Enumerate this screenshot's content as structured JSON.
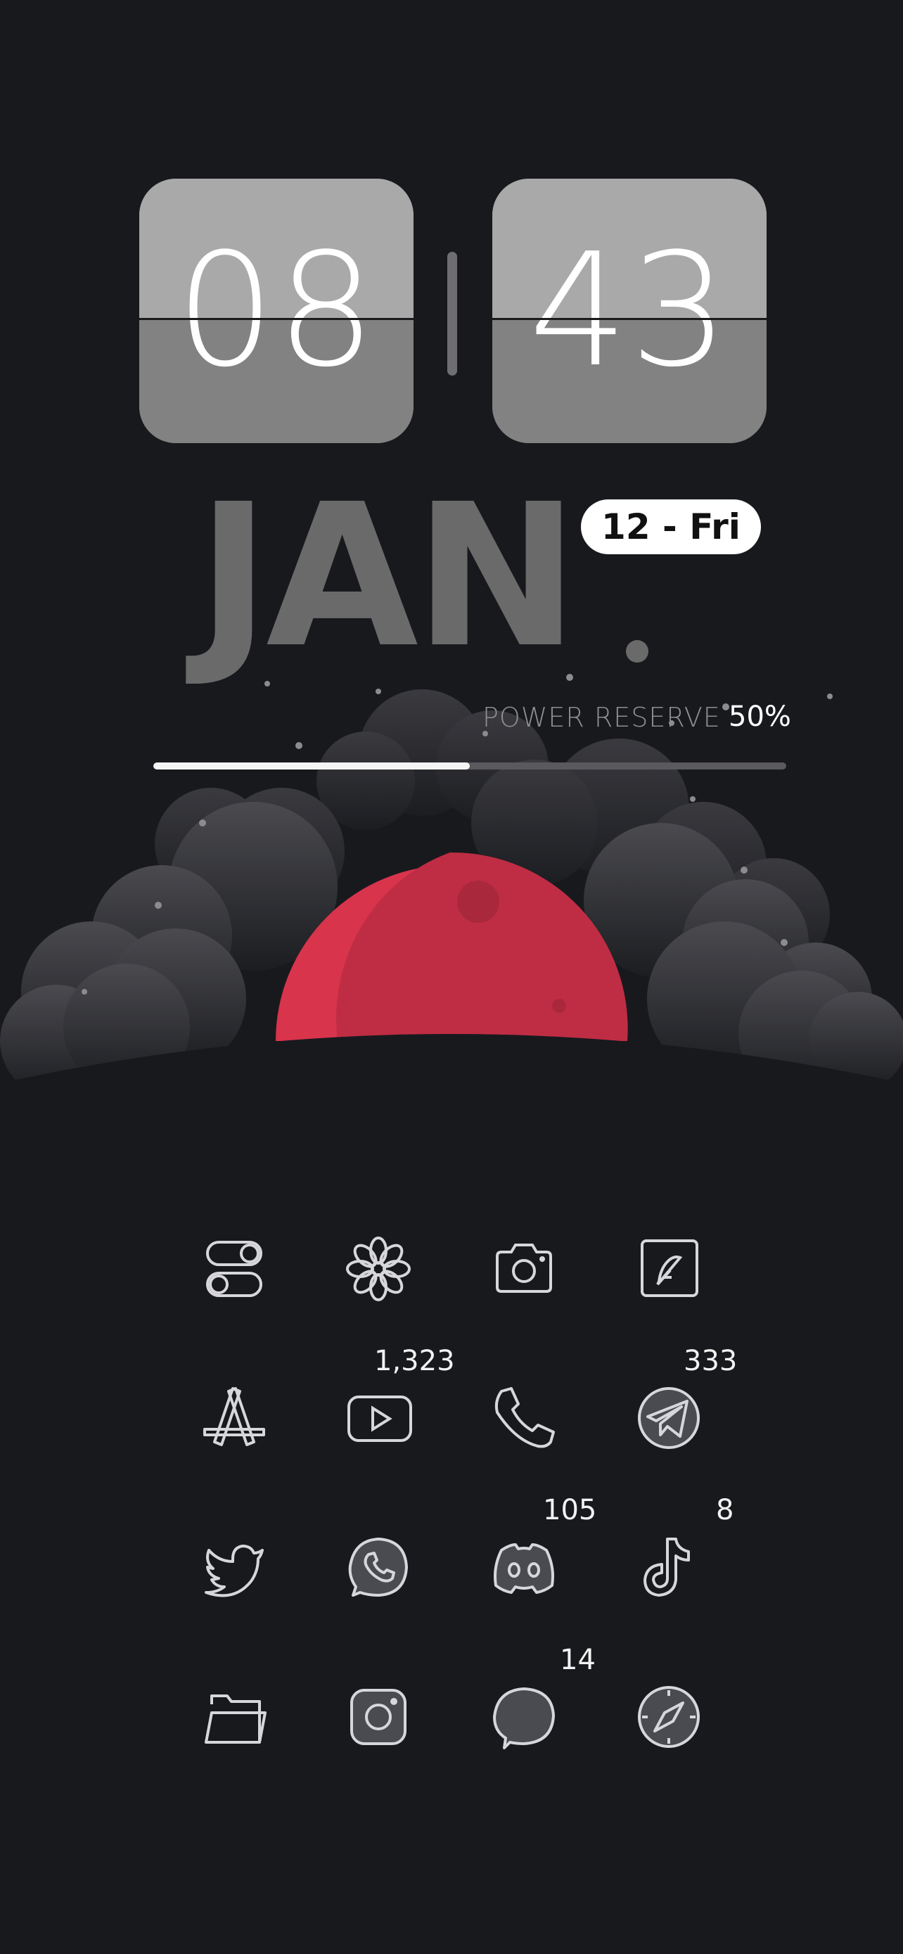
{
  "clock": {
    "hours": "08",
    "minutes": "43"
  },
  "date": {
    "month": "JAN",
    "day_label": "12 - Fri"
  },
  "power_reserve": {
    "label": "POWER RESERVE",
    "value": "50%",
    "fraction": 0.5
  },
  "colors": {
    "moon": "#d8344c",
    "background": "#18191d",
    "icon_stroke": "#d7d7db"
  },
  "apps": [
    {
      "icon": "toggle-icon",
      "badge": ""
    },
    {
      "icon": "flower-icon",
      "badge": ""
    },
    {
      "icon": "camera-icon",
      "badge": ""
    },
    {
      "icon": "notes-feather-icon",
      "badge": ""
    },
    {
      "icon": "app-store-icon",
      "badge": ""
    },
    {
      "icon": "youtube-icon",
      "badge": "1,323"
    },
    {
      "icon": "phone-icon",
      "badge": ""
    },
    {
      "icon": "telegram-icon",
      "badge": "333"
    },
    {
      "icon": "twitter-icon",
      "badge": ""
    },
    {
      "icon": "whatsapp-icon",
      "badge": ""
    },
    {
      "icon": "discord-icon",
      "badge": "105"
    },
    {
      "icon": "tiktok-icon",
      "badge": "8"
    },
    {
      "icon": "files-folder-icon",
      "badge": ""
    },
    {
      "icon": "instagram-icon",
      "badge": ""
    },
    {
      "icon": "messages-icon",
      "badge": "14"
    },
    {
      "icon": "safari-compass-icon",
      "badge": ""
    }
  ]
}
